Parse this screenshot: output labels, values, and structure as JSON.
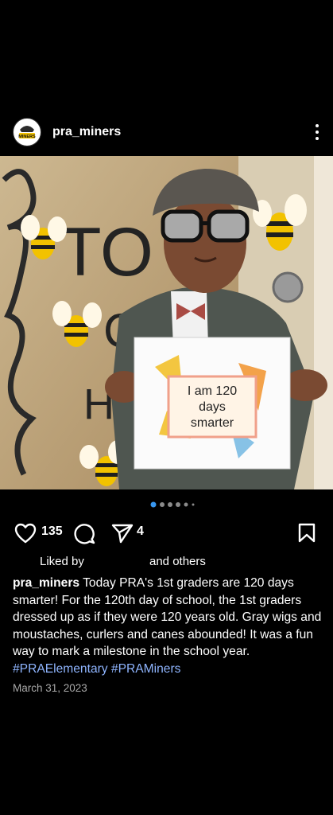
{
  "post": {
    "username": "pra_miners",
    "avatar_text": "MINERS",
    "photo": {
      "sign_text": "I am 120 days smarter",
      "sign_lines": [
        "I am 120",
        "days",
        "smarter"
      ],
      "door_letters": "TO",
      "door_letters_2": "CO",
      "door_letters_3": "H"
    },
    "carousel": {
      "active_index": 1,
      "count": 6
    },
    "actions": {
      "like_icon": "heart-icon",
      "like_count": "135",
      "comment_icon": "comment-icon",
      "share_icon": "send-icon",
      "share_count": "4",
      "save_icon": "bookmark-icon"
    },
    "liked_by": {
      "prefix": "Liked by",
      "suffix": "and others"
    },
    "caption": {
      "username": "pra_miners",
      "text": "Today PRA's 1st graders are 120 days smarter! For the 120th day of school, the 1st graders dressed up as if they were 120 years old. Gray wigs and moustaches, curlers and canes abounded! It was a fun way to mark a milestone in the school year.",
      "hashtags": "#PRAElementary #PRAMiners"
    },
    "date": "March 31, 2023"
  }
}
